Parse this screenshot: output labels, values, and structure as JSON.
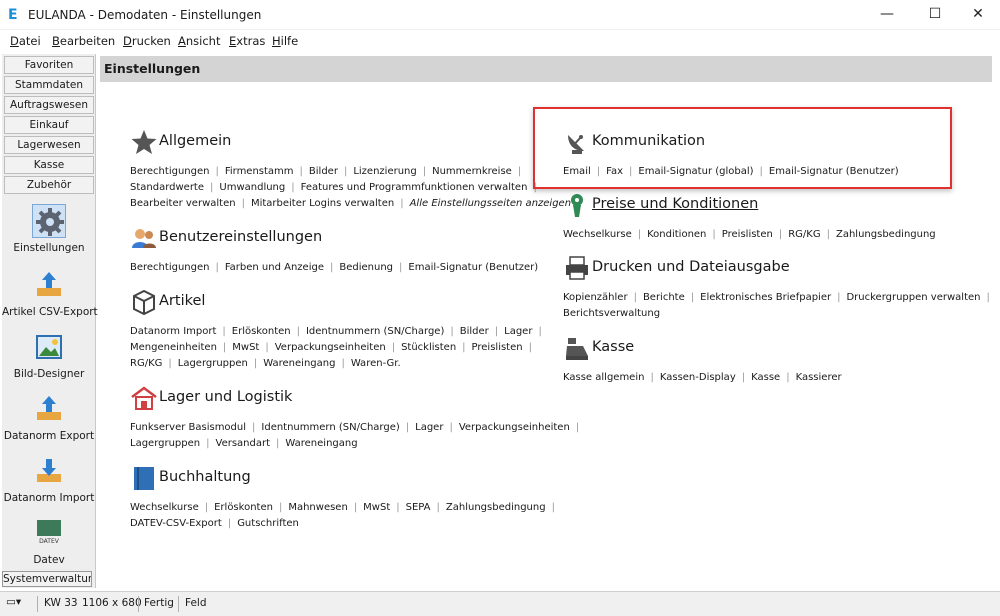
{
  "window": {
    "title": "EULANDA - Demodaten - Einstellungen",
    "minimize": "—",
    "maximize": "☐",
    "close": "✕"
  },
  "menu": [
    "Datei",
    "Bearbeiten",
    "Drucken",
    "Ansicht",
    "Extras",
    "Hilfe"
  ],
  "sidebar": {
    "nav": [
      "Favoriten",
      "Stammdaten",
      "Auftragswesen",
      "Einkauf",
      "Lagerwesen",
      "Kasse",
      "Zubehör"
    ],
    "tools": [
      {
        "label": "Einstellungen",
        "icon": "gear-icon",
        "active": true
      },
      {
        "label": "Artikel CSV-Export",
        "icon": "upload-tray-icon"
      },
      {
        "label": "Bild-Designer",
        "icon": "picture-icon"
      },
      {
        "label": "Datanorm Export",
        "icon": "upload-tray-icon"
      },
      {
        "label": "Datanorm Import",
        "icon": "download-tray-icon"
      },
      {
        "label": "Datev",
        "icon": "datev-icon",
        "icon_text": "DATEV"
      }
    ],
    "system": "Systemverwaltung"
  },
  "header": {
    "title": "Einstellungen"
  },
  "sections": {
    "allgemein": {
      "title": "Allgemein",
      "icon": "star-icon",
      "lines": [
        [
          "Berechtigungen",
          "Firmenstamm",
          "Bilder",
          "Lizenzierung",
          "Nummernkreise"
        ],
        [
          "Standardwerte",
          "Umwandlung",
          "Features und Programmfunktionen verwalten"
        ],
        [
          "Bearbeiter verwalten",
          "Mitarbeiter Logins verwalten",
          "Alle Einstellungsseiten anzeigen"
        ]
      ]
    },
    "benutzer": {
      "title": "Benutzereinstellungen",
      "icon": "users-icon",
      "lines": [
        [
          "Berechtigungen",
          "Farben und Anzeige",
          "Bedienung",
          "Email-Signatur (Benutzer)"
        ]
      ]
    },
    "artikel": {
      "title": "Artikel",
      "icon": "box-icon",
      "lines": [
        [
          "Datanorm Import",
          "Erlöskonten",
          "Identnummern (SN/Charge)",
          "Bilder",
          "Lager"
        ],
        [
          "Mengeneinheiten",
          "MwSt",
          "Verpackungseinheiten",
          "Stücklisten",
          "Preislisten"
        ],
        [
          "RG/KG",
          "Lagergruppen",
          "Wareneingang",
          "Waren-Gr."
        ]
      ]
    },
    "lager": {
      "title": "Lager und Logistik",
      "icon": "warehouse-icon",
      "lines": [
        [
          "Funkserver Basismodul",
          "Identnummern (SN/Charge)",
          "Lager",
          "Verpackungseinheiten"
        ],
        [
          "Lagergruppen",
          "Versandart",
          "Wareneingang"
        ]
      ]
    },
    "buchhaltung": {
      "title": "Buchhaltung",
      "icon": "ledger-icon",
      "lines": [
        [
          "Wechselkurse",
          "Erlöskonten",
          "Mahnwesen",
          "MwSt",
          "SEPA",
          "Zahlungsbedingung"
        ],
        [
          "DATEV-CSV-Export",
          "Gutschriften"
        ]
      ]
    },
    "kommunikation": {
      "title": "Kommunikation",
      "icon": "satellite-dish-icon",
      "lines": [
        [
          "Email",
          "Fax",
          "Email-Signatur (global)",
          "Email-Signatur (Benutzer)"
        ]
      ]
    },
    "preise": {
      "title": "Preise und Konditionen",
      "icon": "price-tag-icon",
      "lines": [
        [
          "Wechselkurse",
          "Konditionen",
          "Preislisten",
          "RG/KG",
          "Zahlungsbedingung"
        ]
      ]
    },
    "drucken": {
      "title": "Drucken und Dateiausgabe",
      "icon": "printer-icon",
      "lines": [
        [
          "Kopienzähler",
          "Berichte",
          "Elektronisches Briefpapier",
          "Druckergruppen verwalten"
        ],
        [
          "Berichtsverwaltung"
        ]
      ]
    },
    "kasse": {
      "title": "Kasse",
      "icon": "cash-register-icon",
      "lines": [
        [
          "Kasse allgemein",
          "Kassen-Display",
          "Kasse",
          "Kassierer"
        ]
      ]
    }
  },
  "status": {
    "kw": "KW 33",
    "size": "1106 x 680",
    "state": "Fertig",
    "field": "Feld"
  },
  "colors": {
    "accent": "#1b8fd8",
    "highlight": "#e03030",
    "header_bg": "#d4d4d4"
  }
}
